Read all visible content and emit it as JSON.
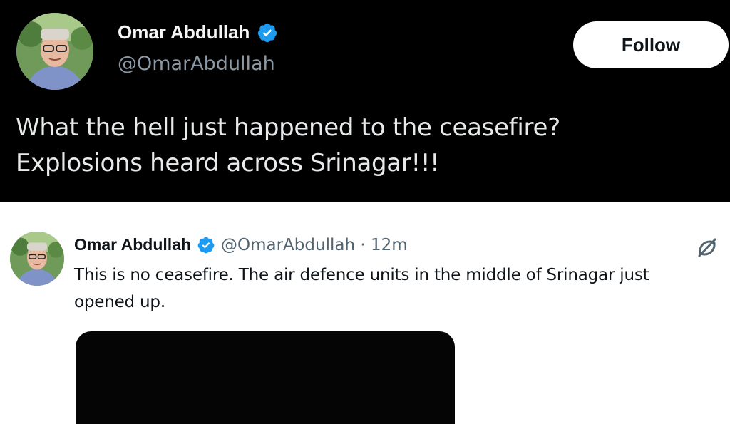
{
  "top_tweet": {
    "author_name": "Omar Abdullah",
    "handle": "@OmarAbdullah",
    "follow_label": "Follow",
    "text_line1": "What the hell just happened to the ceasefire?",
    "text_line2": "Explosions heard across Srinagar!!!"
  },
  "quoted_tweet": {
    "author_name": "Omar Abdullah",
    "handle_time": "@OmarAbdullah · 12m",
    "text_line1": "This is no ceasefire. The air defence units in the middle of Srinagar just",
    "text_line2": "opened up."
  },
  "colors": {
    "verified_blue": "#1d9bf0",
    "dark_background": "#000000",
    "light_background": "#ffffff",
    "follow_button_bg": "#ffffff"
  },
  "icons": [
    "verified-badge-icon",
    "grok-icon"
  ]
}
